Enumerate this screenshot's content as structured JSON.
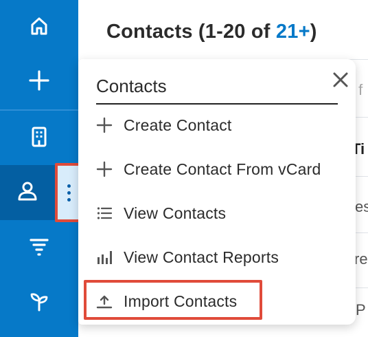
{
  "rail": {
    "items": [
      {
        "id": "home",
        "icon": "home-icon"
      },
      {
        "id": "quick-create",
        "icon": "plus-icon"
      },
      {
        "id": "accounts",
        "icon": "building-icon"
      },
      {
        "id": "contacts",
        "icon": "person-icon",
        "active": true
      },
      {
        "id": "leads",
        "icon": "filter-icon"
      },
      {
        "id": "opportunities",
        "icon": "sprout-icon"
      }
    ],
    "active_color": "#045fa2",
    "color": "#0679c8"
  },
  "main": {
    "title_prefix": "Contacts (1-20 of ",
    "title_count": "21+",
    "title_suffix": ")",
    "bg_fragments": [
      "y f",
      "Ti",
      "es",
      "re",
      "P"
    ]
  },
  "menu": {
    "title": "Contacts",
    "items": [
      {
        "label": "Create Contact",
        "icon": "plus-icon"
      },
      {
        "label": "Create Contact From vCard",
        "icon": "plus-icon"
      },
      {
        "label": "View Contacts",
        "icon": "list-icon"
      },
      {
        "label": "View Contact Reports",
        "icon": "bar-chart-icon"
      },
      {
        "label": "Import Contacts",
        "icon": "upload-icon",
        "highlighted": true
      }
    ],
    "highlight_color": "#e04b3a"
  }
}
